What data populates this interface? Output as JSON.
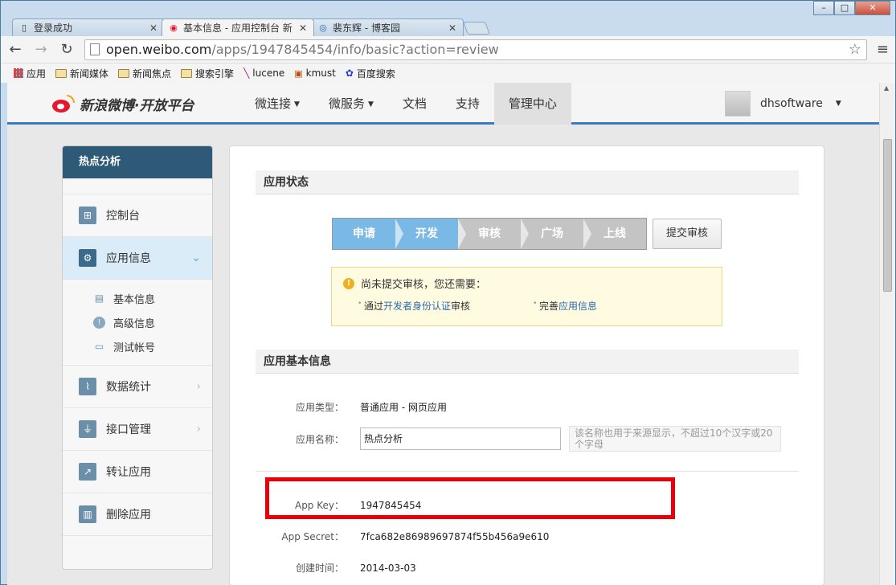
{
  "browser": {
    "tabs": [
      {
        "title": "登录成功",
        "active": false,
        "icon": "page-icon"
      },
      {
        "title": "基本信息 - 应用控制台 新",
        "active": true,
        "icon": "weibo-icon"
      },
      {
        "title": "裴东辉 - 博客园",
        "active": false,
        "icon": "cnblogs-icon"
      }
    ],
    "url_host": "open.weibo.com",
    "url_path": "/apps/1947845454/info/basic?action=review",
    "bookmarks": [
      "应用",
      "新闻媒体",
      "新闻焦点",
      "搜索引擎",
      "lucene",
      "kmust",
      "百度搜索"
    ]
  },
  "header": {
    "logo_text": "新浪微博·开放平台",
    "nav": [
      {
        "label": "微连接",
        "dropdown": true
      },
      {
        "label": "微服务",
        "dropdown": true
      },
      {
        "label": "文档",
        "dropdown": false
      },
      {
        "label": "支持",
        "dropdown": false
      },
      {
        "label": "管理中心",
        "dropdown": false,
        "active": true
      }
    ],
    "username": "dhsoftware"
  },
  "sidebar": {
    "title": "热点分析",
    "items": [
      {
        "label": "控制台",
        "icon": "dashboard-icon"
      },
      {
        "label": "应用信息",
        "icon": "gear-icon",
        "active": true
      },
      {
        "label": "数据统计",
        "icon": "chart-icon"
      },
      {
        "label": "接口管理",
        "icon": "plug-icon"
      },
      {
        "label": "转让应用",
        "icon": "share-icon"
      },
      {
        "label": "删除应用",
        "icon": "trash-icon"
      }
    ],
    "subitems": [
      {
        "label": "基本信息",
        "icon": "card-icon"
      },
      {
        "label": "高级信息",
        "icon": "info-icon"
      },
      {
        "label": "测试帐号",
        "icon": "id-icon"
      }
    ]
  },
  "status": {
    "section_title": "应用状态",
    "steps": [
      {
        "label": "申请",
        "done": true
      },
      {
        "label": "开发",
        "done": true
      },
      {
        "label": "审核",
        "done": false
      },
      {
        "label": "广场",
        "done": false
      },
      {
        "label": "上线",
        "done": false
      }
    ],
    "submit_label": "提交审核",
    "notice_title": "尚未提交审核，您还需要：",
    "notice_item1_pre": "通过",
    "notice_item1_link": "开发者身份认证",
    "notice_item1_post": "审核",
    "notice_item2_pre": "完善",
    "notice_item2_link": "应用信息"
  },
  "basic": {
    "section_title": "应用基本信息",
    "type_label": "应用类型：",
    "type_value": "普通应用 - 网页应用",
    "name_label": "应用名称：",
    "name_value": "热点分析",
    "name_hint": "该名称也用于来源显示，不超过10个汉字或20个字母",
    "appkey_label": "App Key：",
    "appkey_value": "1947845454",
    "secret_label": "App Secret：",
    "secret_value": "7fca682e86989697874f55b456a9e610",
    "created_label": "创建时间：",
    "created_value": "2014-03-03"
  },
  "colors": {
    "header_accent": "#3b7bbf",
    "sidebar_head": "#2e5a78",
    "step_done": "#7ab8e6",
    "highlight": "#e8000c"
  }
}
